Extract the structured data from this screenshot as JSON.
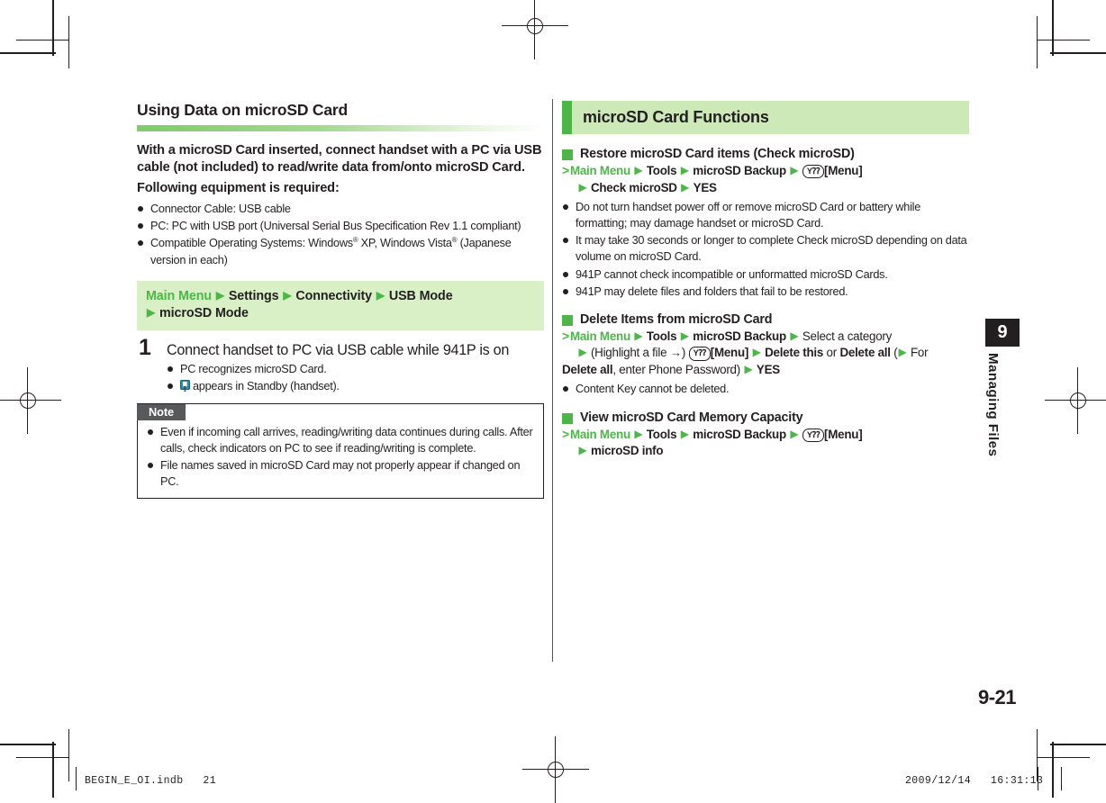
{
  "left": {
    "section_title": "Using Data on microSD Card",
    "lead_paragraph": "With a microSD Card inserted, connect handset with a PC via USB cable (not included) to read/write data from/onto microSD Card.",
    "lead_paragraph2": "Following equipment is required:",
    "requirements": [
      "Connector Cable: USB cable",
      "PC: PC with USB port (Universal Serial Bus Specification Rev 1.1 compliant)"
    ],
    "requirement_os_pre": "Compatible Operating Systems: Windows",
    "requirement_os_sup1": "®",
    "requirement_os_mid": " XP, Windows Vista",
    "requirement_os_sup2": "®",
    "requirement_os_post": " (Japanese version in each)",
    "navbox": {
      "root": "Main Menu",
      "items": [
        "Settings",
        "Connectivity",
        "USB Mode",
        "microSD Mode"
      ],
      "arrow": "▶"
    },
    "step": {
      "number": "1",
      "text": "Connect handset to PC via USB cable while 941P is on",
      "bullets": [
        "PC recognizes microSD Card.",
        "appears in Standby (handset)."
      ],
      "icon_name": "usb-standby-icon"
    },
    "note": {
      "label": "Note",
      "items": [
        "Even if incoming call arrives, reading/writing data continues during calls. After calls, check indicators on PC to see if reading/writing is complete.",
        "File names saved in microSD Card may not properly appear if changed on PC."
      ]
    }
  },
  "right": {
    "header": "microSD Card Functions",
    "blocks": [
      {
        "heading": "Restore microSD Card items (Check microSD)",
        "path_line1": {
          "gt": ">",
          "root": "Main Menu",
          "steps": [
            "Tools",
            "microSD Backup"
          ],
          "key_label": "Y⁇",
          "key_text": "[Menu]"
        },
        "path_line2": [
          "Check microSD",
          "YES"
        ],
        "bullets": [
          "Do not turn handset power off or remove microSD Card or battery while formatting; may damage handset or microSD Card.",
          "It may take 30 seconds or longer to complete Check microSD depending on data volume on microSD Card.",
          "941P cannot check incompatible or unformatted microSD Cards.",
          "941P may delete files and folders that fail to be restored."
        ]
      },
      {
        "heading": "Delete Items from microSD Card",
        "path_text": "Main Menu ▶ Tools ▶ microSD Backup ▶ Select a category ▶ (Highlight a file →) [Menu] ▶ Delete this or Delete all (▶ For Delete all, enter Phone Password) ▶ YES",
        "bullets": [
          "Content Key cannot be deleted."
        ]
      },
      {
        "heading": "View microSD Card Memory Capacity",
        "path_text": "Main Menu ▶ Tools ▶ microSD Backup ▶ [Menu] ▶ microSD info",
        "bullets": []
      }
    ],
    "labels": {
      "select_category": "Select a category",
      "highlight_file": "(Highlight a file →)",
      "menu_text": "[Menu]",
      "delete_this": "Delete this",
      "or": "or",
      "delete_all": "Delete all",
      "for_paren": "(",
      "for": "For",
      "delete_all2": "Delete all",
      "enter_password": ", enter Phone Password)",
      "yes": "YES",
      "microsd_info": "microSD info",
      "check_microsd": "Check microSD",
      "yes2": "YES",
      "tools": "Tools",
      "microsd_backup": "microSD Backup",
      "main_menu": "Main Menu",
      "key_label": "Y⁇"
    }
  },
  "chapter_tab": {
    "number": "9",
    "title": "Managing Files"
  },
  "page_number": "9-21",
  "footer": {
    "left": "BEGIN_E_OI.indb   21",
    "right": "2009/12/14   16:31:13"
  },
  "colors": {
    "green_accent": "#4cb648",
    "green_light": "#cde9b8",
    "green_box": "#d9f0c6",
    "ink": "#231f20",
    "note_label_bg": "#58595b"
  }
}
